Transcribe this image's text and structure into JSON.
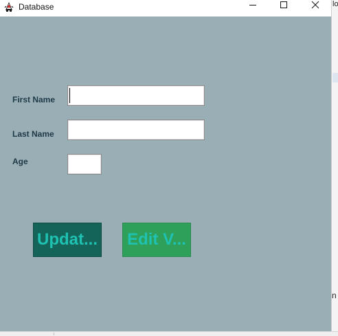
{
  "window": {
    "title": "Database",
    "app_icon": "java-duke-icon",
    "controls": {
      "minimize": "minimize-icon",
      "maximize": "maximize-icon",
      "close": "close-icon"
    }
  },
  "form": {
    "first_name_label": "First Name",
    "first_name_value": "",
    "last_name_label": "Last Name",
    "last_name_value": "",
    "age_label": "Age",
    "age_value": ""
  },
  "buttons": {
    "update_label": "Updat...",
    "edit_label": "Edit V..."
  },
  "background_window": {
    "fragment_top": "lo",
    "fragment_bottom": "n"
  },
  "colors": {
    "panel_background": "#9aaeb6",
    "label_text": "#1e3a46",
    "update_button_bg": "#14645a",
    "edit_button_bg": "#2ea05a",
    "button_text": "#1fc2b2"
  }
}
